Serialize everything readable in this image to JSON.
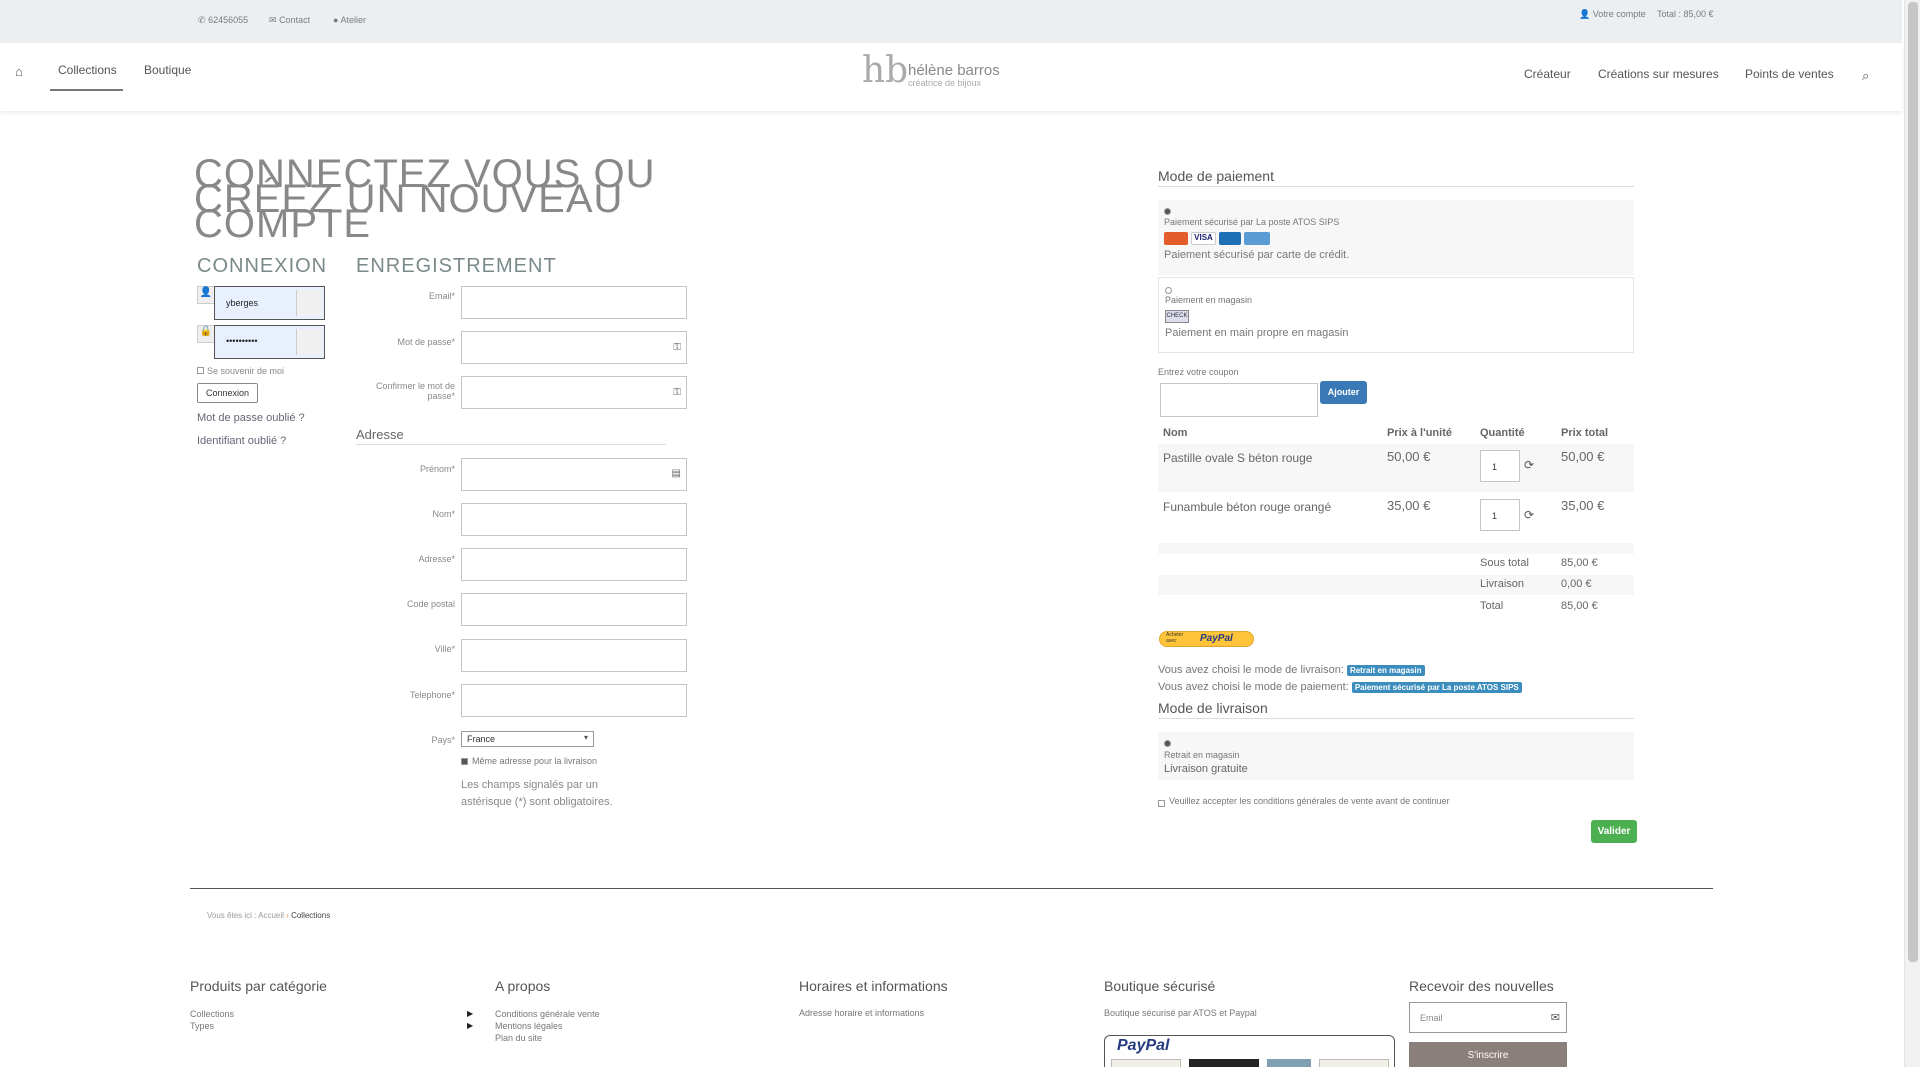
{
  "topbar": {
    "phone": "62456055",
    "contact": "Contact",
    "atelier": "Atelier",
    "account": "Votre compte",
    "total": "Total : 85,00 €"
  },
  "nav": {
    "collections": "Collections",
    "boutique": "Boutique",
    "logo_initials": "hb",
    "logo_name": "hélène barros",
    "logo_tagline": "créatrice de bijoux",
    "createur": "Créateur",
    "creations": "Créations sur mesures",
    "points": "Points de ventes"
  },
  "page": {
    "title": "CONNECTEZ VOUS OU CRÉEZ UN NOUVEAU COMPTE"
  },
  "login": {
    "title": "CONNEXION",
    "username": "yberges",
    "password": "••••••••••",
    "remember": "Se souvenir de moi",
    "button": "Connexion",
    "forgot_password": "Mot de passe oublié ?",
    "forgot_id": "Identifiant oublié ?"
  },
  "register": {
    "title": "ENREGISTREMENT",
    "email": "Email*",
    "password": "Mot de passe*",
    "confirm1": "Confirmer le mot de",
    "confirm2": "passe*",
    "address_title": "Adresse",
    "prenom": "Prénom*",
    "nom": "Nom*",
    "adresse": "Adresse*",
    "code_postal": "Code postal",
    "ville": "Ville*",
    "telephone": "Telephone*",
    "pays": "Pays*",
    "pays_value": "France",
    "same_address": "Même adresse pour la livraison",
    "note1": "Les champs signalés par un",
    "note2": "astérisque (*) sont obligatoires."
  },
  "payment": {
    "title": "Mode de paiement",
    "opt1_label": "Paiement sécurisé par La poste ATOS SIPS",
    "opt1_desc": "Paiement sécurisé par carte de crédit.",
    "opt2_label": "Paiement en magasin",
    "opt2_icon": "CHECK",
    "opt2_desc": "Paiement en main propre en magasin",
    "coupon_label": "Entrez votre coupon",
    "coupon_button": "Ajouter"
  },
  "cart": {
    "headers": [
      "Nom",
      "Prix à l'unité",
      "Quantité",
      "Prix total"
    ],
    "rows": [
      {
        "name": "Pastille ovale S béton rouge",
        "unit": "50,00 €",
        "qty": "1",
        "total": "50,00 €"
      },
      {
        "name": "Funambule béton rouge orangé",
        "unit": "35,00 €",
        "qty": "1",
        "total": "35,00 €"
      }
    ],
    "subtotal_label": "Sous total",
    "subtotal": "85,00 €",
    "shipping_label": "Livraison",
    "shipping": "0,00 €",
    "total_label": "Total",
    "total": "85,00 €"
  },
  "paypal_btn": {
    "small": "Acheter avec",
    "brand": "PayPal"
  },
  "choices": {
    "delivery_text": "Vous avez choisi le mode de livraison:",
    "delivery_badge": "Retrait en magasin",
    "payment_text": "Vous avez choisi le mode de paiement:",
    "payment_badge": "Paiement sécurisé par La poste ATOS SIPS"
  },
  "delivery": {
    "title": "Mode de livraison",
    "opt_label": "Retrait en magasin",
    "opt_desc": "Livraison gratuite",
    "cgv": "Veuillez accepter les conditions générales de vente avant de continuer",
    "validate": "Valider"
  },
  "breadcrumb": {
    "prefix": "Vous êtes ici :",
    "home": "Accueil",
    "current": "Collections"
  },
  "footer": {
    "col1_title": "Produits par catégorie",
    "col1_links": [
      "Collections",
      "Types"
    ],
    "col2_title": "A propos",
    "col2_links": [
      "Conditions générale vente",
      "Mentions légales",
      "Plan du site"
    ],
    "col3_title": "Horaires et informations",
    "col3_link": "Adresse horaire et informations",
    "col4_title": "Boutique sécurisé",
    "col4_text": "Boutique sécurisé par ATOS et Paypal",
    "col4_paypal": "PayPal",
    "col5_title": "Recevoir des nouvelles",
    "email_placeholder": "Email",
    "subscribe": "S'inscrire"
  },
  "colors": {
    "accent_blue": "#3b79b6",
    "valid_green": "#4caf50",
    "badge_blue": "#3a8dbd",
    "subscribe_bg": "#8a7f7a"
  }
}
